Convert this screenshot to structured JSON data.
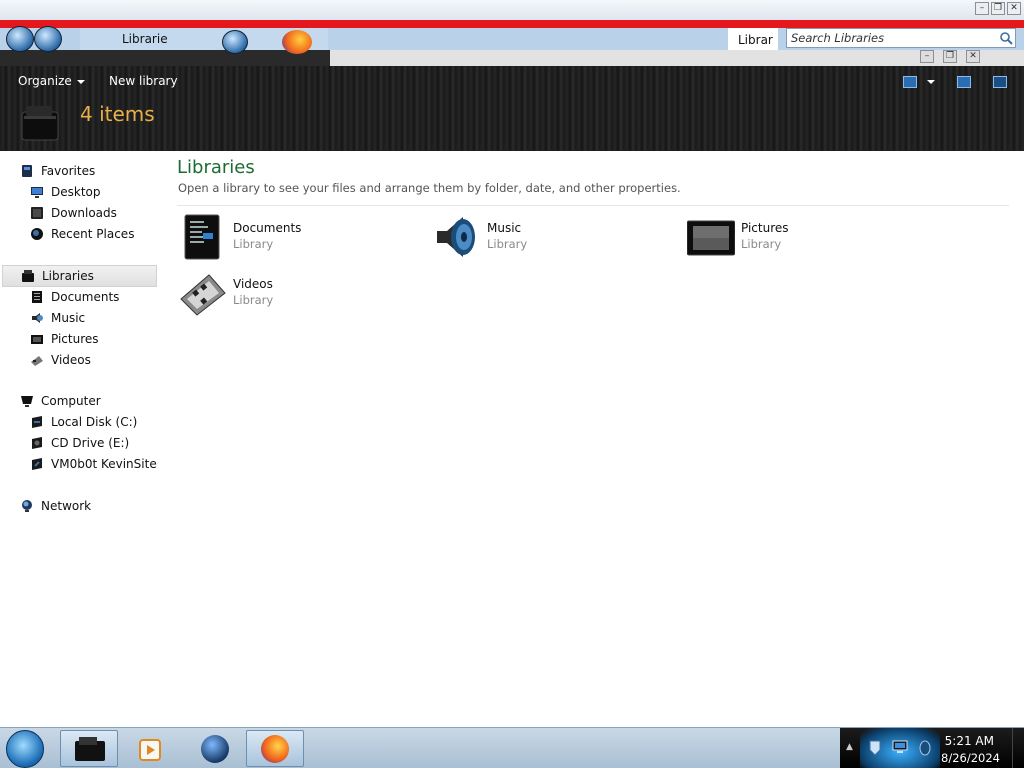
{
  "window": {
    "tab_label": "Librarie",
    "address_fragment": "Librar",
    "search_placeholder": "Search Libraries"
  },
  "commandbar": {
    "organize_label": "Organize",
    "new_library_label": "New library",
    "item_count": "4 items"
  },
  "nav": {
    "favorites": {
      "label": "Favorites",
      "items": [
        "Desktop",
        "Downloads",
        "Recent Places"
      ]
    },
    "libraries": {
      "label": "Libraries",
      "items": [
        "Documents",
        "Music",
        "Pictures",
        "Videos"
      ]
    },
    "computer": {
      "label": "Computer",
      "items": [
        "Local Disk (C:)",
        "CD Drive (E:)",
        "VM0b0t KevinSite"
      ]
    },
    "network": {
      "label": "Network"
    }
  },
  "content": {
    "title": "Libraries",
    "description": "Open a library to see your files and arrange them by folder, date, and other properties.",
    "libraries": [
      {
        "name": "Documents",
        "type": "Library",
        "icon": "documents-library-icon"
      },
      {
        "name": "Music",
        "type": "Library",
        "icon": "music-library-icon"
      },
      {
        "name": "Pictures",
        "type": "Library",
        "icon": "pictures-library-icon"
      },
      {
        "name": "Videos",
        "type": "Library",
        "icon": "videos-library-icon"
      }
    ]
  },
  "taskbar": {
    "time": "5:21 AM",
    "date": "8/26/2024"
  },
  "colors": {
    "title_green": "#1e6b32",
    "count_orange": "#e8b04a",
    "header_dark": "#1b1b1b"
  }
}
